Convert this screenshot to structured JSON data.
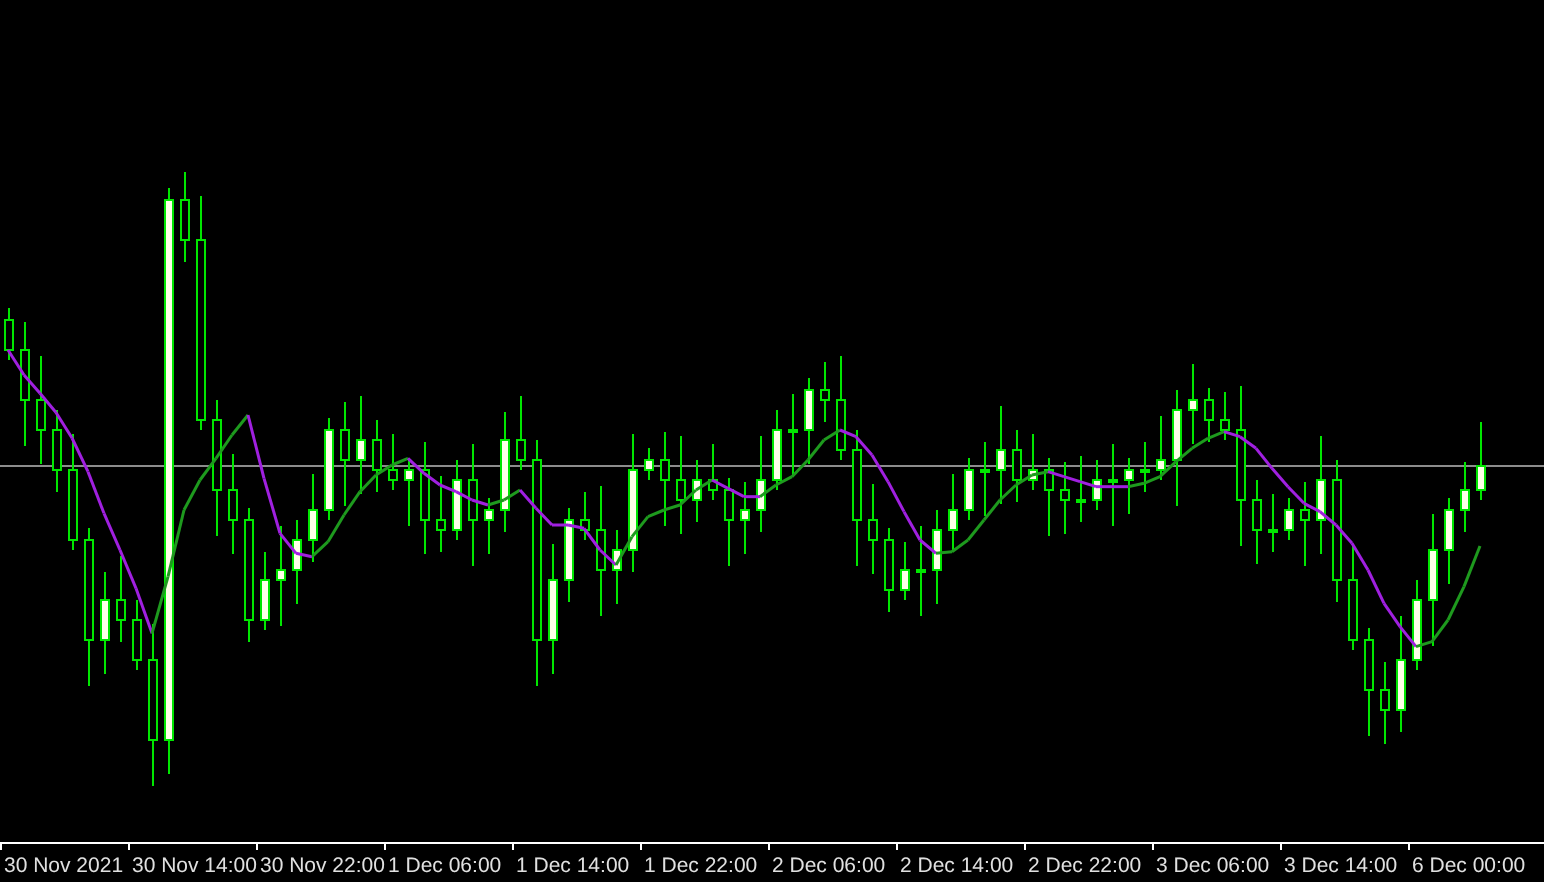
{
  "chart": {
    "time_labels": [
      "30 Nov 2021",
      "30 Nov 14:00",
      "30 Nov 22:00",
      "1 Dec 06:00",
      "1 Dec 14:00",
      "1 Dec 22:00",
      "2 Dec 06:00",
      "2 Dec 14:00",
      "2 Dec 22:00",
      "3 Dec 06:00",
      "3 Dec 14:00",
      "6 Dec 00:00"
    ]
  }
}
